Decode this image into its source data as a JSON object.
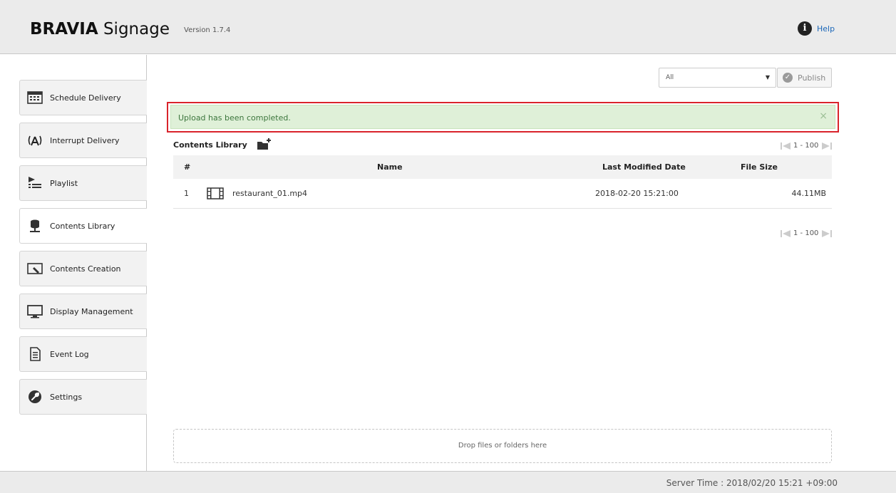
{
  "header": {
    "brand_bold": "BRAVIA",
    "brand_rest": "Signage",
    "version": "Version 1.7.4",
    "help_label": "Help"
  },
  "sidebar": {
    "items": [
      {
        "label": "Schedule Delivery",
        "icon": "calendar-icon"
      },
      {
        "label": "Interrupt Delivery",
        "icon": "broadcast-icon"
      },
      {
        "label": "Playlist",
        "icon": "playlist-icon"
      },
      {
        "label": "Contents Library",
        "icon": "database-icon",
        "active": true
      },
      {
        "label": "Contents Creation",
        "icon": "edit-screen-icon"
      },
      {
        "label": "Display Management",
        "icon": "monitor-icon"
      },
      {
        "label": "Event Log",
        "icon": "document-icon"
      },
      {
        "label": "Settings",
        "icon": "wrench-icon"
      }
    ]
  },
  "toolbar": {
    "filter_value": "All",
    "publish_label": "Publish"
  },
  "alert": {
    "message": "Upload has been completed.",
    "close": "×",
    "status_color": "#dff0d8"
  },
  "library": {
    "title": "Contents Library",
    "pager_top": "1 - 100",
    "pager_bottom": "1 - 100",
    "columns": [
      "#",
      "Name",
      "Last Modified Date",
      "File Size"
    ],
    "rows": [
      {
        "num": "1",
        "name": "restaurant_01.mp4",
        "modified": "2018-02-20 15:21:00",
        "size": "44.11MB"
      }
    ],
    "dropzone": "Drop files or folders here"
  },
  "footer": {
    "server_time": "Server Time : 2018/02/20 15:21 +09:00"
  }
}
